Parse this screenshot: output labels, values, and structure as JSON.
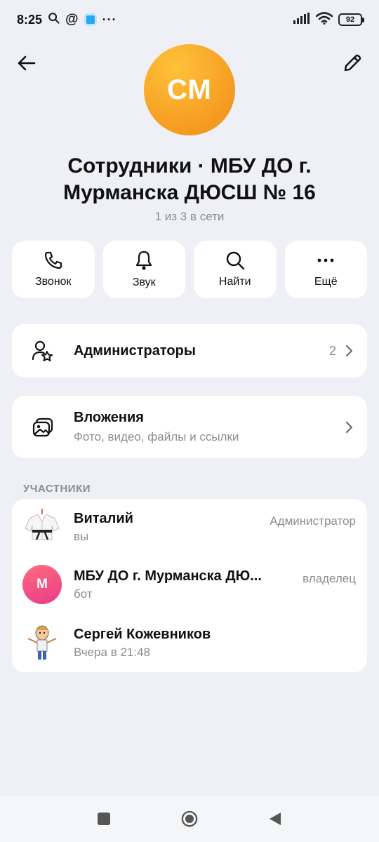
{
  "status": {
    "time": "8:25",
    "battery": "92",
    "extra_icons": [
      "search-icon",
      "at-icon",
      "app-icon",
      "more-icon"
    ]
  },
  "header": {
    "avatar_initials": "СМ",
    "title": "Сотрудники · МБУ ДО г. Мурманска ДЮСШ № 16",
    "subtitle": "1 из 3 в сети"
  },
  "actions": [
    {
      "label": "Звонок",
      "icon": "phone-icon"
    },
    {
      "label": "Звук",
      "icon": "bell-icon"
    },
    {
      "label": "Найти",
      "icon": "search-icon"
    },
    {
      "label": "Ещё",
      "icon": "more-icon"
    }
  ],
  "admins": {
    "label": "Администраторы",
    "count": "2"
  },
  "attachments": {
    "label": "Вложения",
    "subtitle": "Фото, видео, файлы и ссылки"
  },
  "members_section": "УЧАСТНИКИ",
  "members": [
    {
      "name": "Виталий",
      "sub": "вы",
      "role": "Администратор"
    },
    {
      "name": "МБУ ДО г. Мурманска ДЮ...",
      "sub": "бот",
      "role": "владелец",
      "initial": "М"
    },
    {
      "name": "Сергей Кожевников",
      "sub": "Вчера в 21:48",
      "role": ""
    }
  ],
  "colors": {
    "avatar": "#f59b21",
    "background": "#eef0f5",
    "bot_avatar": "#ee4a84"
  }
}
